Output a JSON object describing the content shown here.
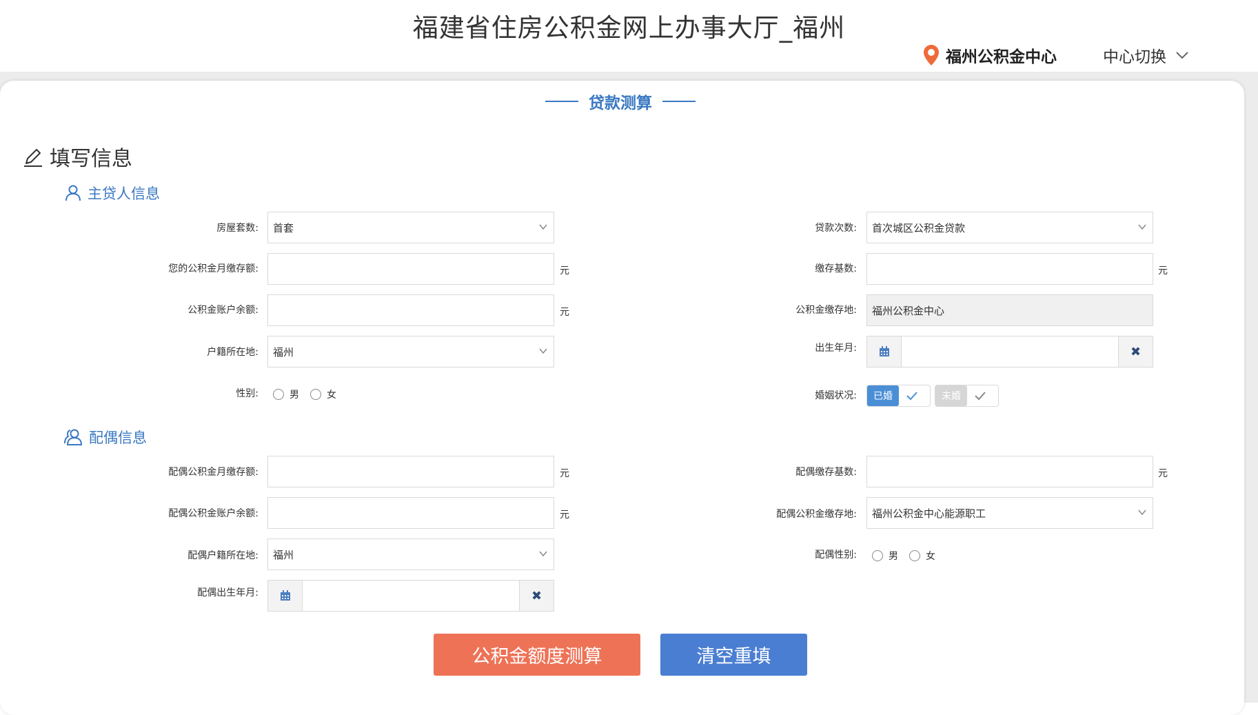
{
  "header": {
    "title": "福建省住房公积金网上办事大厅_福州",
    "center_name": "福州公积金中心",
    "switch_label": "中心切换"
  },
  "card": {
    "heading": "贷款测算",
    "section_title": "填写信息"
  },
  "borrower": {
    "title": "主贷人信息",
    "house_count": {
      "label": "房屋套数:",
      "value": "首套"
    },
    "loan_times": {
      "label": "贷款次数:",
      "value": "首次城区公积金贷款"
    },
    "monthly_deposit": {
      "label": "您的公积金月缴存额:",
      "value": "",
      "unit": "元"
    },
    "deposit_base": {
      "label": "缴存基数:",
      "value": "",
      "unit": "元"
    },
    "account_balance": {
      "label": "公积金账户余额:",
      "value": "",
      "unit": "元"
    },
    "deposit_place": {
      "label": "公积金缴存地:",
      "value": "福州公积金中心"
    },
    "hukou": {
      "label": "户籍所在地:",
      "value": "福州"
    },
    "birth": {
      "label": "出生年月:",
      "value": ""
    },
    "gender": {
      "label": "性别:",
      "options": [
        "男",
        "女"
      ]
    },
    "marital": {
      "label": "婚姻状况:",
      "married": "已婚",
      "unmarried": "未婚"
    }
  },
  "spouse": {
    "title": "配偶信息",
    "monthly_deposit": {
      "label": "配偶公积金月缴存额:",
      "value": "",
      "unit": "元"
    },
    "deposit_base": {
      "label": "配偶缴存基数:",
      "value": "",
      "unit": "元"
    },
    "account_balance": {
      "label": "配偶公积金账户余额:",
      "value": "",
      "unit": "元"
    },
    "deposit_place": {
      "label": "配偶公积金缴存地:",
      "value": "福州公积金中心能源职工"
    },
    "hukou": {
      "label": "配偶户籍所在地:",
      "value": "福州"
    },
    "gender": {
      "label": "配偶性别:",
      "options": [
        "男",
        "女"
      ]
    },
    "birth": {
      "label": "配偶出生年月:",
      "value": ""
    }
  },
  "buttons": {
    "calculate": "公积金额度测算",
    "reset": "清空重填"
  },
  "colors": {
    "accent": "#3a78c2",
    "primary_button": "#ee7256",
    "secondary_button": "#4a7ed2",
    "pin": "#ef6a3a"
  }
}
